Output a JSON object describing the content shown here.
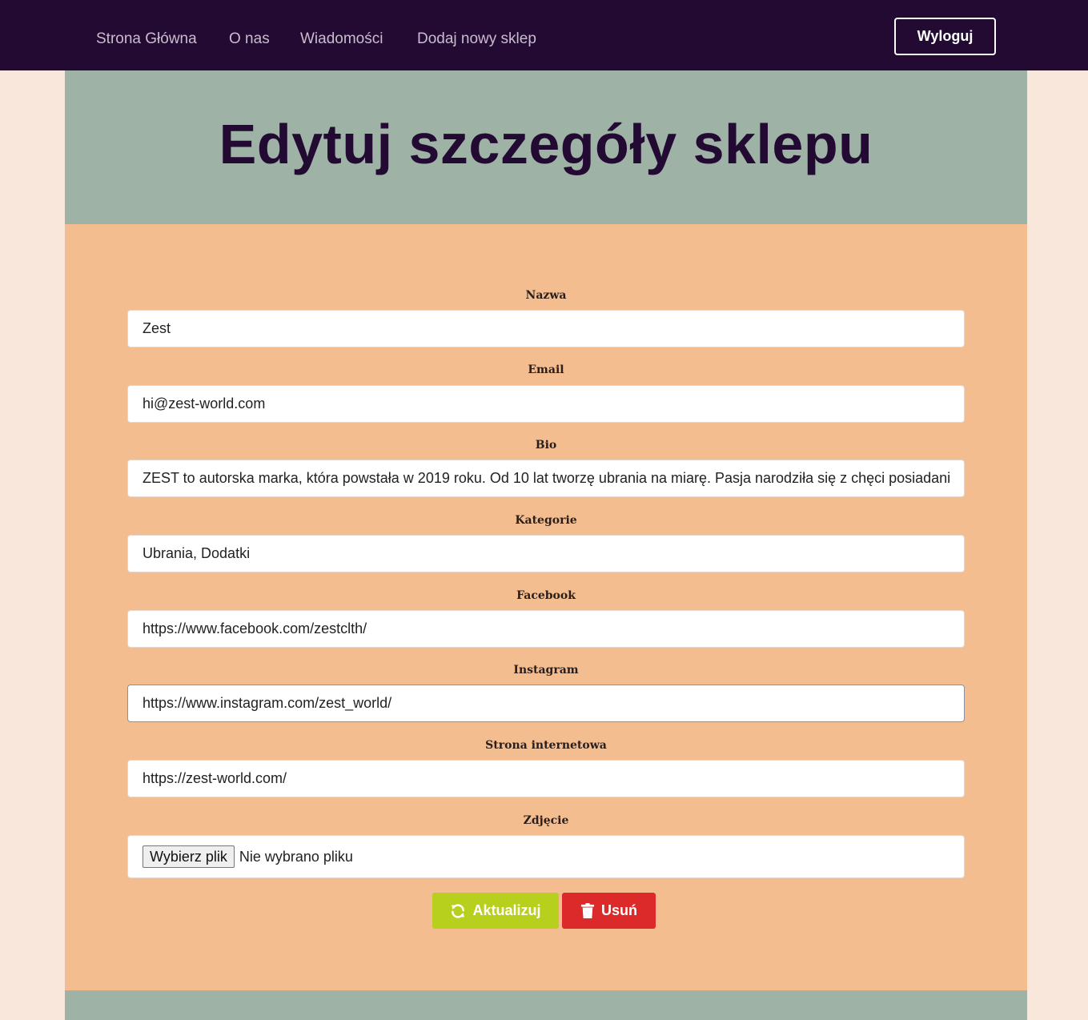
{
  "nav": {
    "links": [
      "Strona Główna",
      "O nas",
      "Wiadomości",
      "Dodaj nowy sklep"
    ],
    "logout_label": "Wyloguj"
  },
  "header": {
    "title": "Edytuj szczegóły sklepu"
  },
  "form": {
    "fields": [
      {
        "label": "Nazwa",
        "value": "Zest"
      },
      {
        "label": "Email",
        "value": "hi@zest-world.com"
      },
      {
        "label": "Bio",
        "value": "ZEST to autorska marka, która powstała w 2019 roku. Od 10 lat tworzę ubrania na miarę. Pasja narodziła się z chęci posiadania wyma"
      },
      {
        "label": "Kategorie",
        "value": "Ubrania, Dodatki"
      },
      {
        "label": "Facebook",
        "value": "https://www.facebook.com/zestclth/"
      },
      {
        "label": "Instagram",
        "value": "https://www.instagram.com/zest_world/"
      },
      {
        "label": "Strona internetowa",
        "value": "https://zest-world.com/"
      }
    ],
    "photo": {
      "label": "Zdjęcie",
      "button_label": "Wybierz plik",
      "status": "Nie wybrano pliku"
    },
    "update_label": "Aktualizuj",
    "delete_label": "Usuń"
  },
  "colors": {
    "navbar": "#230a33",
    "header_band": "#9eb2a6",
    "form_bg": "#f4bd90",
    "page_bg": "#f9e7dc",
    "update": "#b7cf1d",
    "delete": "#dc2a2a"
  },
  "icons": {
    "update": "refresh-icon",
    "delete": "trash-icon"
  }
}
